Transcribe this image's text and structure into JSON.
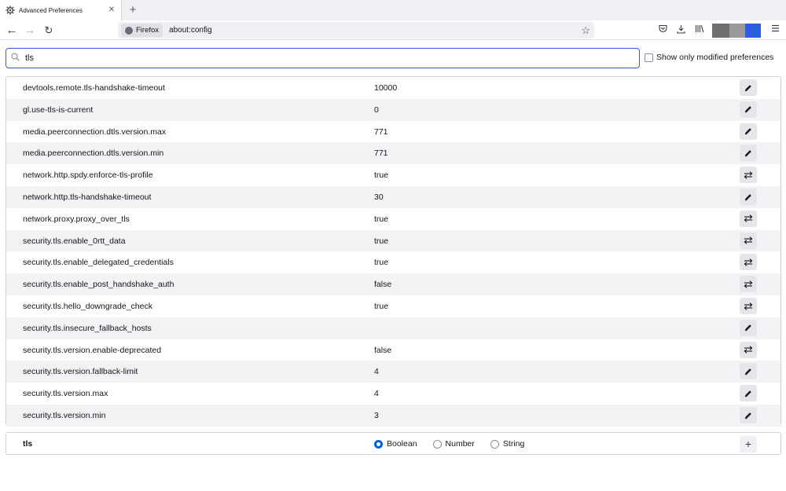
{
  "window": {
    "tab_title": "Advanced Preferences",
    "tab_icon": "gear-icon",
    "new_tab": "+"
  },
  "nav": {
    "identity_label": "Firefox",
    "url": "about:config"
  },
  "search": {
    "value": "tls",
    "modified_label": "Show only modified preferences"
  },
  "prefs": [
    {
      "name": "devtools.remote.tls-handshake-timeout",
      "value": "10000",
      "action": "edit"
    },
    {
      "name": "gl.use-tls-is-current",
      "value": "0",
      "action": "edit"
    },
    {
      "name": "media.peerconnection.dtls.version.max",
      "value": "771",
      "action": "edit"
    },
    {
      "name": "media.peerconnection.dtls.version.min",
      "value": "771",
      "action": "edit"
    },
    {
      "name": "network.http.spdy.enforce-tls-profile",
      "value": "true",
      "action": "toggle"
    },
    {
      "name": "network.http.tls-handshake-timeout",
      "value": "30",
      "action": "edit"
    },
    {
      "name": "network.proxy.proxy_over_tls",
      "value": "true",
      "action": "toggle"
    },
    {
      "name": "security.tls.enable_0rtt_data",
      "value": "true",
      "action": "toggle"
    },
    {
      "name": "security.tls.enable_delegated_credentials",
      "value": "true",
      "action": "toggle"
    },
    {
      "name": "security.tls.enable_post_handshake_auth",
      "value": "false",
      "action": "toggle"
    },
    {
      "name": "security.tls.hello_downgrade_check",
      "value": "true",
      "action": "toggle"
    },
    {
      "name": "security.tls.insecure_fallback_hosts",
      "value": "",
      "action": "edit"
    },
    {
      "name": "security.tls.version.enable-deprecated",
      "value": "false",
      "action": "toggle"
    },
    {
      "name": "security.tls.version.fallback-limit",
      "value": "4",
      "action": "edit"
    },
    {
      "name": "security.tls.version.max",
      "value": "4",
      "action": "edit"
    },
    {
      "name": "security.tls.version.min",
      "value": "3",
      "action": "edit"
    }
  ],
  "add_row": {
    "name": "tls",
    "types": [
      {
        "label": "Boolean",
        "checked": true
      },
      {
        "label": "Number",
        "checked": false
      },
      {
        "label": "String",
        "checked": false
      }
    ],
    "add_label": "+"
  },
  "colors": {
    "accent": "#0061e0",
    "search_border": "#2d62d9",
    "swatches": [
      "#6e6e6e",
      "#9a9a9a",
      "#5a5a5a",
      "#2f5fe0"
    ]
  }
}
